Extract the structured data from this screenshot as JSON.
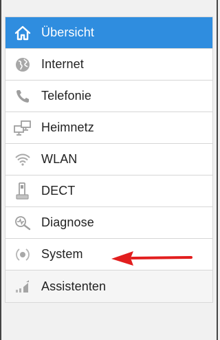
{
  "nav": {
    "items": [
      {
        "label": "Übersicht",
        "icon": "home-icon",
        "active": true
      },
      {
        "label": "Internet",
        "icon": "globe-icon"
      },
      {
        "label": "Telefonie",
        "icon": "phone-icon"
      },
      {
        "label": "Heimnetz",
        "icon": "network-icon"
      },
      {
        "label": "WLAN",
        "icon": "wifi-icon"
      },
      {
        "label": "DECT",
        "icon": "dect-handset-icon"
      },
      {
        "label": "Diagnose",
        "icon": "diagnosis-icon"
      },
      {
        "label": "System",
        "icon": "system-icon"
      }
    ],
    "assistants": {
      "label": "Assistenten",
      "icon": "assistant-icon"
    }
  },
  "colors": {
    "accent": "#2f8ddf",
    "icon_grey": "#9a9a9a",
    "annotation_arrow": "#e21e1e"
  }
}
